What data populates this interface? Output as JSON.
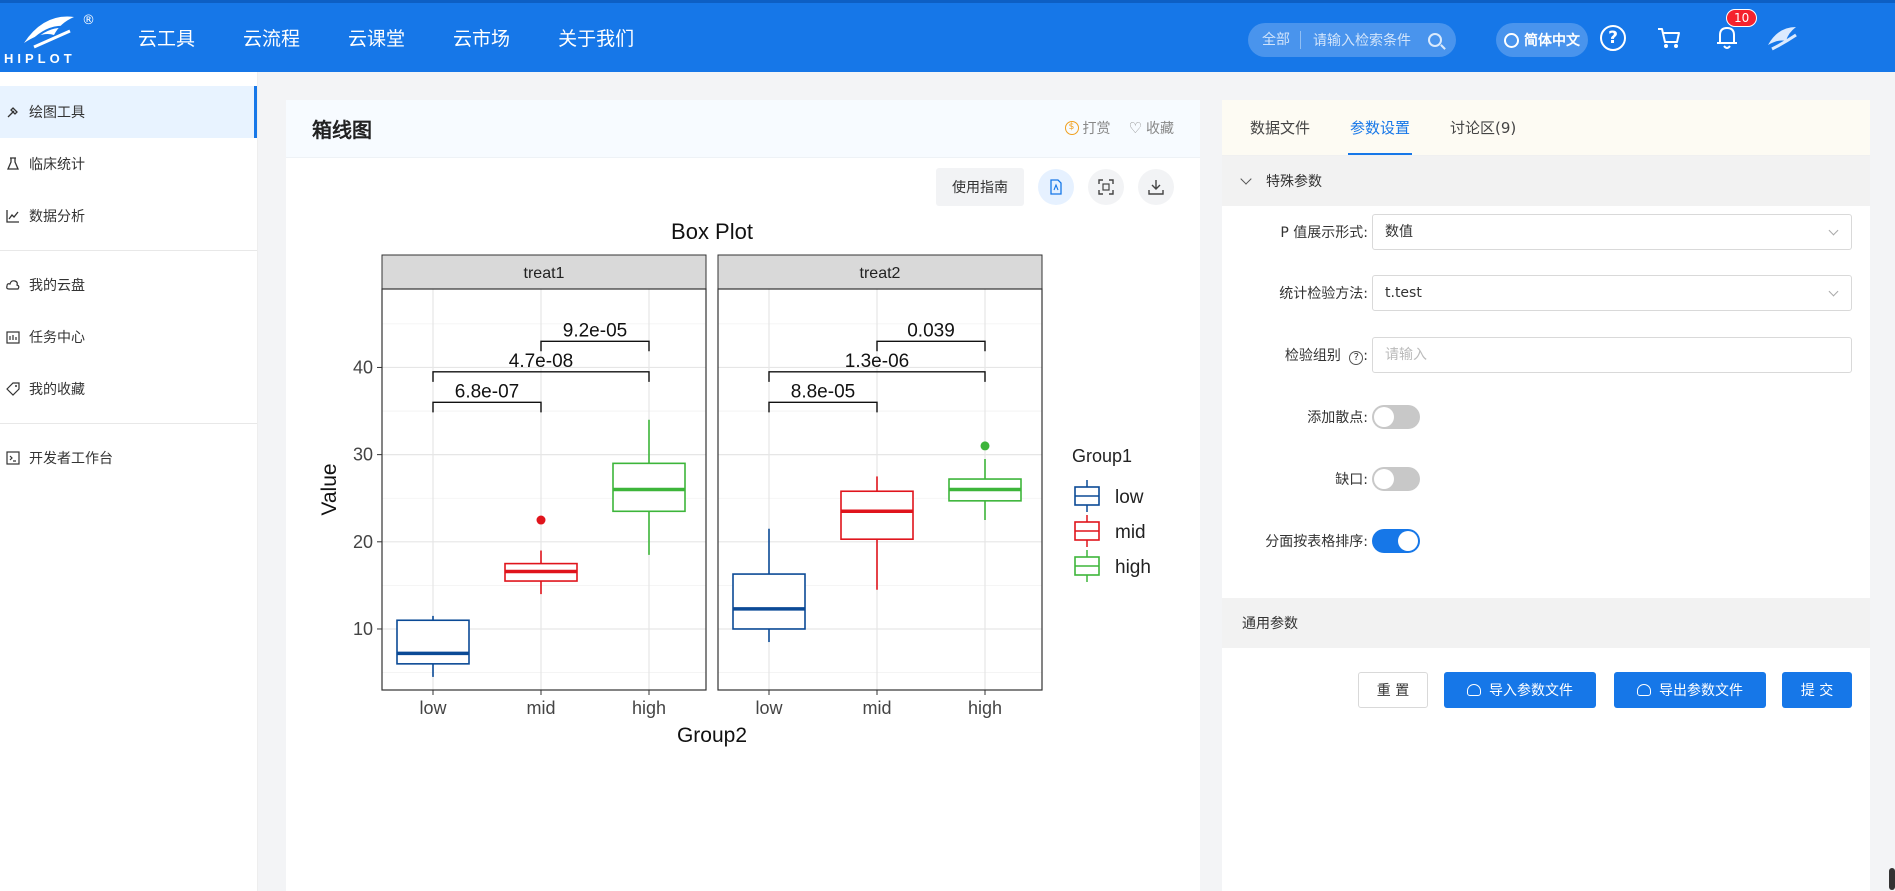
{
  "topbar": {
    "logo_text": "HIPLOT",
    "logo_reg": "®",
    "nav": [
      "云工具",
      "云流程",
      "云课堂",
      "云市场",
      "关于我们"
    ],
    "search_scope": "全部",
    "search_placeholder": "请输入检索条件",
    "language": "简体中文",
    "help": "?",
    "notification_count": "10",
    "brand_color": "#1677e8"
  },
  "sidebar": {
    "items": [
      {
        "label": "绘图工具",
        "icon": "brush-icon"
      },
      {
        "label": "临床统计",
        "icon": "flask-icon"
      },
      {
        "label": "数据分析",
        "icon": "line-chart-icon"
      },
      {
        "label": "我的云盘",
        "icon": "cloud-icon"
      },
      {
        "label": "任务中心",
        "icon": "task-icon"
      },
      {
        "label": "我的收藏",
        "icon": "tag-icon"
      },
      {
        "label": "开发者工作台",
        "icon": "terminal-icon"
      }
    ]
  },
  "center": {
    "title": "箱线图",
    "reward": "打赏",
    "favorite": "收藏",
    "guide_button": "使用指南"
  },
  "right": {
    "tabs": [
      "数据文件",
      "参数设置",
      "讨论区(9)"
    ],
    "special_section": "特殊参数",
    "general_section": "通用参数",
    "fields": {
      "p_display_label": "P 值展示形式:",
      "p_display_value": "数值",
      "test_method_label": "统计检验方法:",
      "test_method_value": "t.test",
      "test_group_label": "检验组别",
      "test_group_placeholder": "请输入",
      "add_points_label": "添加散点:",
      "notch_label": "缺口:",
      "facet_sort_label": "分面按表格排序:"
    },
    "toggles": {
      "add_points": false,
      "notch": false,
      "facet_sort": true
    },
    "buttons": {
      "reset": "重 置",
      "import": "导入参数文件",
      "export": "导出参数文件",
      "submit": "提 交"
    }
  },
  "chart_data": {
    "type": "box",
    "title": "Box Plot",
    "xlabel": "Group2",
    "ylabel": "Value",
    "ylim": [
      3,
      49
    ],
    "yticks": [
      10,
      20,
      30,
      40
    ],
    "categories": [
      "low",
      "mid",
      "high"
    ],
    "legend": {
      "title": "Group1",
      "entries": [
        "low",
        "mid",
        "high"
      ],
      "colors": [
        "#0b4a96",
        "#e0141c",
        "#3db53a"
      ]
    },
    "facets": [
      {
        "name": "treat1",
        "boxes": [
          {
            "group": "low",
            "min": 4.5,
            "q1": 6,
            "median": 7.2,
            "q3": 11,
            "max": 11.5,
            "outliers": []
          },
          {
            "group": "mid",
            "min": 14,
            "q1": 15.5,
            "median": 16.6,
            "q3": 17.5,
            "max": 19,
            "outliers": [
              22.5
            ]
          },
          {
            "group": "high",
            "min": 18.5,
            "q1": 23.5,
            "median": 26,
            "q3": 29,
            "max": 34,
            "outliers": []
          }
        ],
        "pvalues": [
          {
            "from": "low",
            "to": "mid",
            "label": "6.8e-07",
            "y": 36
          },
          {
            "from": "low",
            "to": "high",
            "label": "4.7e-08",
            "y": 39.5
          },
          {
            "from": "mid",
            "to": "high",
            "label": "9.2e-05",
            "y": 43
          }
        ]
      },
      {
        "name": "treat2",
        "boxes": [
          {
            "group": "low",
            "min": 8.5,
            "q1": 10,
            "median": 12.3,
            "q3": 16.3,
            "max": 21.5,
            "outliers": []
          },
          {
            "group": "mid",
            "min": 14.5,
            "q1": 20.3,
            "median": 23.5,
            "q3": 25.8,
            "max": 27.5,
            "outliers": []
          },
          {
            "group": "high",
            "min": 22.5,
            "q1": 24.7,
            "median": 26,
            "q3": 27.2,
            "max": 29.5,
            "outliers": [
              31
            ]
          }
        ],
        "pvalues": [
          {
            "from": "low",
            "to": "mid",
            "label": "8.8e-05",
            "y": 36
          },
          {
            "from": "low",
            "to": "high",
            "label": "1.3e-06",
            "y": 39.5
          },
          {
            "from": "mid",
            "to": "high",
            "label": "0.039",
            "y": 43
          }
        ]
      }
    ]
  }
}
